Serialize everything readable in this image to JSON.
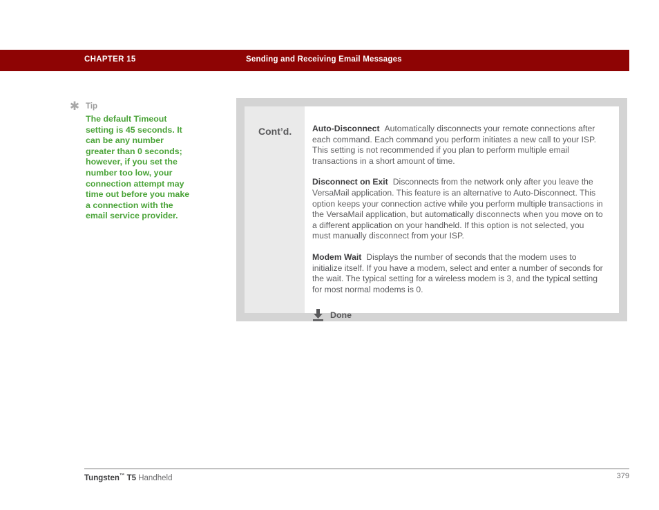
{
  "header": {
    "chapter": "CHAPTER 15",
    "title": "Sending and Receiving Email Messages",
    "background_color": "#8e0404",
    "text_color": "#ffffff"
  },
  "tip": {
    "icon": "asterisk-icon",
    "icon_glyph": "✱",
    "label": "Tip",
    "label_color": "#9a9a9a",
    "body": "The default Timeout setting is 45 seconds. It can be any number greater than 0 seconds; however, if you set the number too low, your connection attempt may time out before you make a connection with the email service provider.",
    "body_color": "#4aa338"
  },
  "panel": {
    "frame_color": "#d4d4d4",
    "side_column_color": "#eaeaea",
    "content_color": "#ffffff",
    "continued_label": "Cont’d.",
    "entries": [
      {
        "term": "Auto-Disconnect",
        "description": "Automatically disconnects your remote connections after each command. Each command you perform initiates a new call to your ISP. This setting is not recommended if you plan to perform multiple email transactions in a short amount of time."
      },
      {
        "term": "Disconnect on Exit",
        "description": "Disconnects from the network only after you leave the VersaMail application. This feature is an alternative to Auto-Disconnect. This option keeps your connection active while you perform multiple transactions in the VersaMail application, but automatically disconnects when you move on to a different application on your handheld. If this option is not selected, you must manually disconnect from your ISP."
      },
      {
        "term": "Modem Wait",
        "description": "Displays the number of seconds that the modem uses to initialize itself. If you have a modem, select and enter a number of seconds for the wait. The typical setting for a wireless modem is 3, and the typical setting for most normal modems is 0."
      }
    ],
    "done": {
      "icon": "download-arrow-icon",
      "label": "Done"
    }
  },
  "footer": {
    "product_bold": "Tungsten",
    "trademark": "™",
    "product_model": "T5",
    "product_suffix": "Handheld",
    "page_number": "379"
  }
}
